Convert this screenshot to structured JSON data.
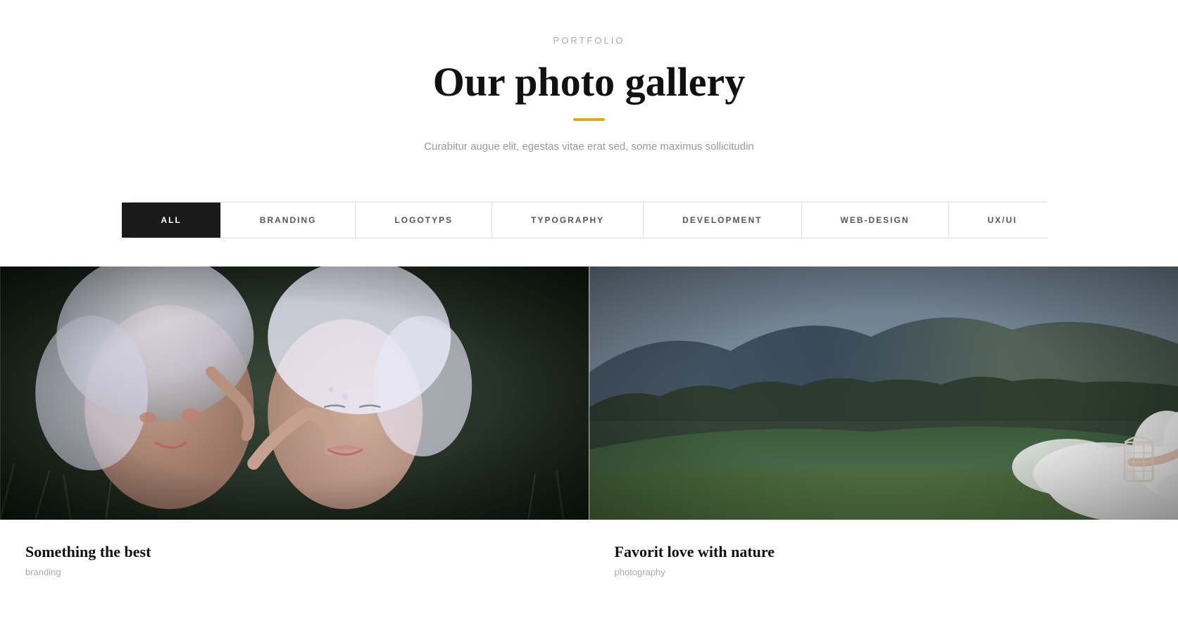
{
  "header": {
    "portfolio_label": "PORTFOLIO",
    "main_title": "Our photo gallery",
    "accent_color": "#e6a817",
    "subtitle": "Curabitur augue elit, egestas vitae erat sed, some maximus sollicitudin"
  },
  "filter_tabs": [
    {
      "id": "all",
      "label": "ALL",
      "active": true
    },
    {
      "id": "branding",
      "label": "BRANDING",
      "active": false
    },
    {
      "id": "logotyps",
      "label": "LOGOTYPS",
      "active": false
    },
    {
      "id": "typography",
      "label": "TYPOGRAPHY",
      "active": false
    },
    {
      "id": "development",
      "label": "DEVELOPMENT",
      "active": false
    },
    {
      "id": "web-design",
      "label": "WEB-DESIGN",
      "active": false
    },
    {
      "id": "ux-ui",
      "label": "UX/UI",
      "active": false
    }
  ],
  "gallery": {
    "items": [
      {
        "id": "item-1",
        "title": "Something the best",
        "category": "branding",
        "alt": "Two women with white/silver hair lying on grass with artistic makeup"
      },
      {
        "id": "item-2",
        "title": "Favorit love with nature",
        "category": "photography",
        "alt": "Bride in white dress lying on hillside with white rabbit and birdcage"
      }
    ]
  }
}
